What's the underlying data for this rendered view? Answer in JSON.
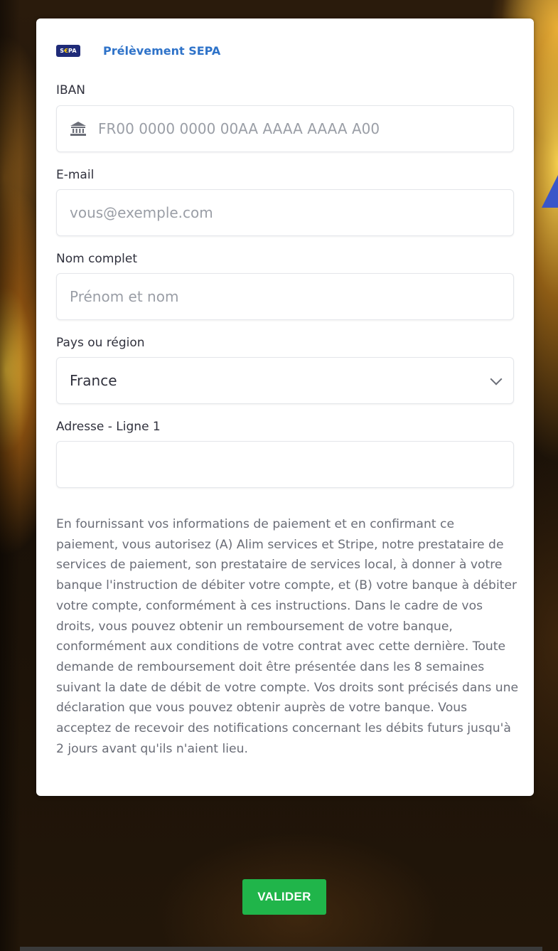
{
  "payment_method": {
    "tab_label": "Prélèvement SEPA",
    "logo_text_left": "S",
    "logo_text_mid": "€",
    "logo_text_right": "PA"
  },
  "form": {
    "iban": {
      "label": "IBAN",
      "placeholder": "FR00 0000 0000 00AA AAAA AAAA A00",
      "icon": "bank-icon"
    },
    "email": {
      "label": "E-mail",
      "placeholder": "vous@exemple.com"
    },
    "full_name": {
      "label": "Nom complet",
      "placeholder": "Prénom et nom"
    },
    "country": {
      "label": "Pays ou région",
      "selected": "France"
    },
    "address_line1": {
      "label": "Adresse - Ligne 1",
      "value": ""
    }
  },
  "legal_text": "En fournissant vos informations de paiement et en confirmant ce paiement, vous autorisez (A) Alim services et Stripe, notre prestataire de services de paiement, son prestataire de services local, à donner à votre banque l'instruction de débiter votre compte, et (B) votre banque à débiter votre compte, conformément à ces instructions. Dans le cadre de vos droits, vous pouvez obtenir un remboursement de votre banque, conformément aux conditions de votre contrat avec cette dernière. Toute demande de remboursement doit être présentée dans les 8 semaines suivant la date de débit de votre compte. Vos droits sont précisés dans une déclaration que vous pouvez obtenir auprès de votre banque. Vous acceptez de recevoir des notifications concernant les débits futurs jusqu'à 2 jours avant qu'ils n'aient lieu.",
  "submit_label": "VALIDER",
  "colors": {
    "tab_accent": "#2f73c9",
    "submit_bg": "#20b54a",
    "sepa_logo_bg": "#1f2b78",
    "page_accent_triangle": "#3a56c9"
  }
}
